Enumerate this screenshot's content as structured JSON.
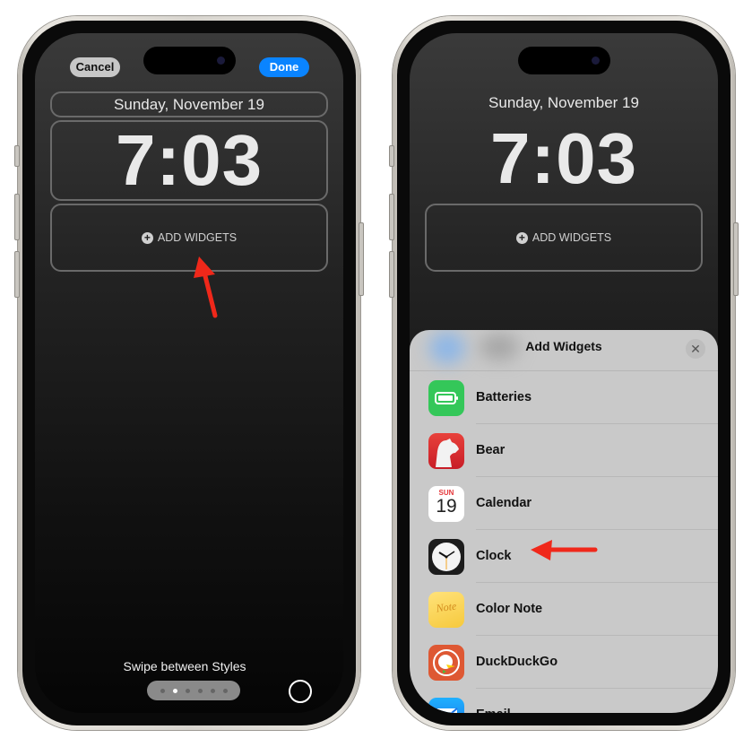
{
  "left_phone": {
    "cancel_label": "Cancel",
    "done_label": "Done",
    "date": "Sunday, November 19",
    "time": "7:03",
    "add_widgets_label": "ADD WIDGETS",
    "swipe_hint": "Swipe between Styles",
    "style_pages": 6,
    "active_style_page": 2
  },
  "right_phone": {
    "date": "Sunday, November 19",
    "time": "7:03",
    "add_widgets_label": "ADD WIDGETS",
    "sheet": {
      "title": "Add Widgets",
      "close_icon": "close-icon",
      "apps": [
        {
          "label": "Batteries",
          "icon": "battery-icon",
          "color": "#34c759"
        },
        {
          "label": "Bear",
          "icon": "bear-icon",
          "color": "#d7262b"
        },
        {
          "label": "Calendar",
          "icon": "calendar-icon",
          "day": "SUN",
          "date": "19"
        },
        {
          "label": "Clock",
          "icon": "clock-icon"
        },
        {
          "label": "Color Note",
          "icon": "note-icon",
          "note_text": "Note"
        },
        {
          "label": "DuckDuckGo",
          "icon": "duckduckgo-icon",
          "color": "#de5833"
        },
        {
          "label": "Email",
          "icon": "mail-icon",
          "color": "#1a8cff"
        }
      ]
    }
  },
  "annotations": {
    "arrow_color": "#f0281a"
  }
}
